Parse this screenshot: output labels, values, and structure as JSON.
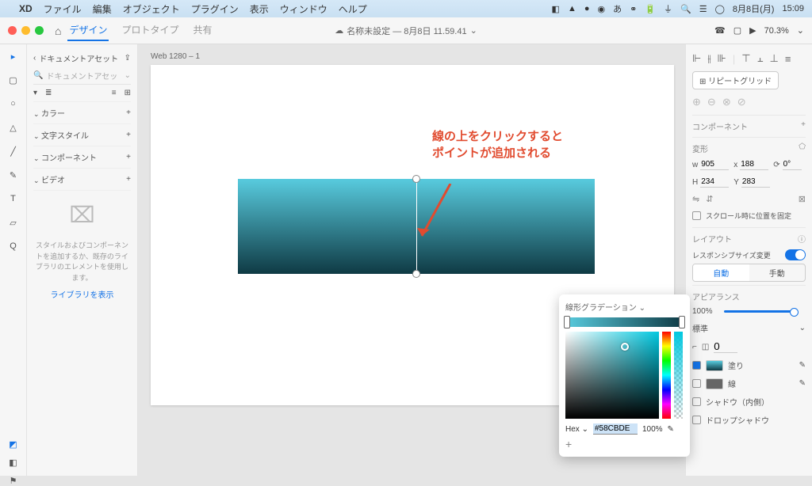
{
  "menubar": {
    "app": "XD",
    "items": [
      "ファイル",
      "編集",
      "オブジェクト",
      "プラグイン",
      "表示",
      "ウィンドウ",
      "ヘルプ"
    ],
    "date": "8月8日(月)",
    "time": "15:09"
  },
  "titlebar": {
    "tabs": {
      "design": "デザイン",
      "prototype": "プロトタイプ",
      "share": "共有"
    },
    "doc_title": "名称未設定 — 8月8日 11.59.41",
    "zoom": "70.3%"
  },
  "left": {
    "assets_label": "ドキュメントアセット",
    "search_ph": "ドキュメントアセッ",
    "sections": {
      "colors": "カラー",
      "charstyles": "文字スタイル",
      "components": "コンポーネント",
      "video": "ビデオ"
    },
    "empty_msg": "スタイルおよびコンポーネントを追加するか、既存のライブラリのエレメントを使用します。",
    "link": "ライブラリを表示"
  },
  "canvas": {
    "artboard_name": "Web 1280 – 1",
    "annotation_l1": "線の上をクリックすると",
    "annotation_l2": "ポイントが追加される"
  },
  "inspector": {
    "repeat_grid": "リピートグリッド",
    "component_hdr": "コンポーネント",
    "transform_hdr": "変形",
    "w": "905",
    "x": "188",
    "rot": "0°",
    "h": "234",
    "y": "283",
    "scroll_fix": "スクロール時に位置を固定",
    "layout_hdr": "レイアウト",
    "responsive": "レスポンシブサイズ変更",
    "auto": "自動",
    "manual": "手動",
    "appearance_hdr": "アピアランス",
    "opacity": "100%",
    "blend": "標準",
    "radius": "0",
    "fill_label": "塗り",
    "stroke_label": "線",
    "shadow_inner": "シャドウ（内側）",
    "drop_shadow": "ドロップシャドウ"
  },
  "popover": {
    "mode": "線形グラデーション",
    "hex_label": "Hex",
    "hex_value": "#58CBDE",
    "alpha": "100%"
  }
}
